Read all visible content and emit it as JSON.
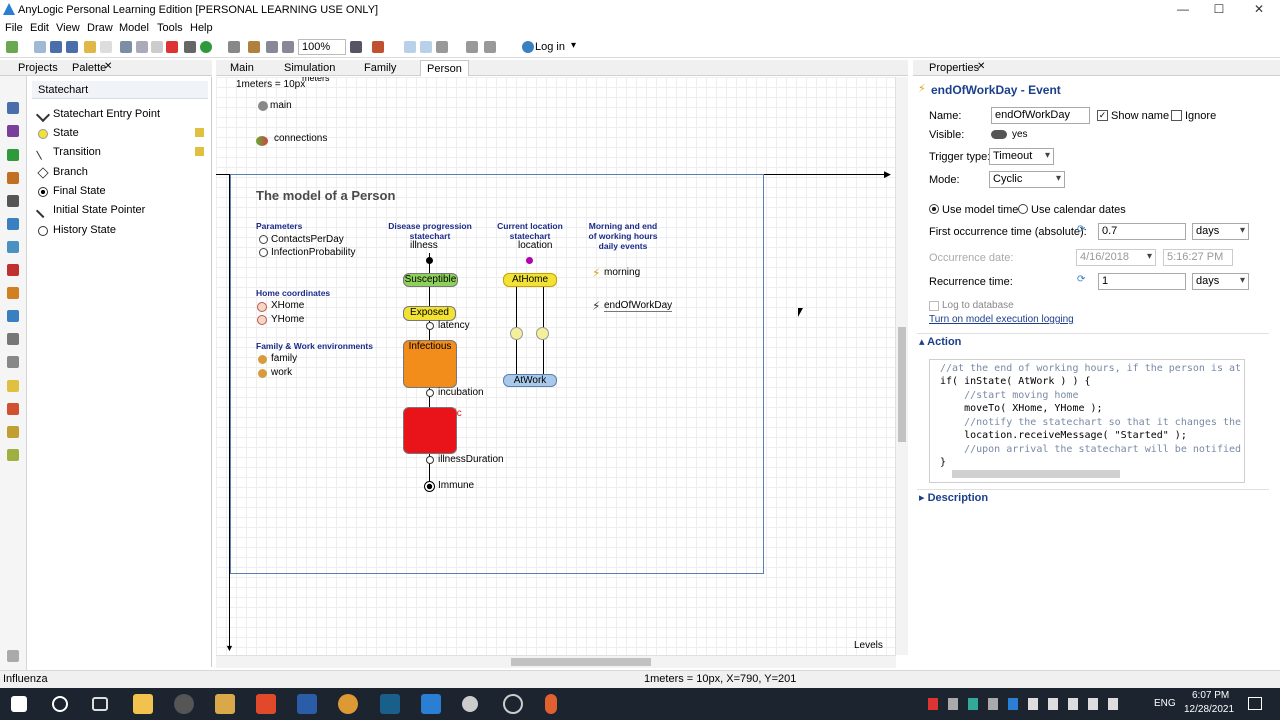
{
  "window": {
    "title": "AnyLogic Personal Learning Edition [PERSONAL LEARNING USE ONLY]",
    "minimize": "—",
    "maximize": "☐",
    "close": "✕"
  },
  "menu": [
    "File",
    "Edit",
    "View",
    "Draw",
    "Model",
    "Tools",
    "Help"
  ],
  "toolbar": {
    "zoom": "100%",
    "login": "Log in"
  },
  "left_panel": {
    "tabs": [
      "Projects",
      "Palette"
    ],
    "palette_section": "Statechart",
    "items": [
      {
        "label": "Statechart Entry Point",
        "icon": "entry-point-icon"
      },
      {
        "label": "State",
        "icon": "state-icon"
      },
      {
        "label": "Transition",
        "icon": "transition-icon"
      },
      {
        "label": "Branch",
        "icon": "branch-icon"
      },
      {
        "label": "Final State",
        "icon": "final-state-icon"
      },
      {
        "label": "Initial State Pointer",
        "icon": "initial-pointer-icon"
      },
      {
        "label": "History State",
        "icon": "history-state-icon"
      }
    ]
  },
  "editor": {
    "tabs": [
      "Main",
      "Simulation",
      "Family",
      "Person"
    ],
    "active_tab": "Person",
    "scale_label": "1meters = 10px",
    "scale_unit": "meters",
    "main_label": "main",
    "connections_label": "connections",
    "frame_title": "The model of a Person",
    "parameters_head": "Parameters",
    "parameters": [
      "ContactsPerDay",
      "InfectionProbability"
    ],
    "home_head": "Home coordinates",
    "home_vars": [
      "XHome",
      "YHome"
    ],
    "env_head": "Family & Work environments",
    "env_vars": [
      "family",
      "work"
    ],
    "disease_head": "Disease progression statechart",
    "disease_name": "illness",
    "disease_states": [
      "Susceptible",
      "Exposed",
      "Infectious",
      "Symptomatic"
    ],
    "disease_transitions": [
      "latency",
      "incubation",
      "illnessDuration"
    ],
    "final_state": "Immune",
    "location_head": "Current location statechart",
    "location_name": "location",
    "location_states": [
      "AtHome",
      "AtWork"
    ],
    "events_head": "Morning and end of working hours daily events",
    "events": [
      "morning",
      "endOfWorkDay"
    ],
    "levels": "Levels"
  },
  "properties": {
    "tab": "Properties",
    "header": "endOfWorkDay - Event",
    "name_label": "Name:",
    "name_value": "endOfWorkDay",
    "show_name": "Show name",
    "show_name_checked": true,
    "ignore": "Ignore",
    "visible_label": "Visible:",
    "visible_value": "yes",
    "trigger_label": "Trigger type:",
    "trigger_value": "Timeout",
    "mode_label": "Mode:",
    "mode_value": "Cyclic",
    "time_model": "Use model time",
    "time_calendar": "Use calendar dates",
    "first_label": "First occurrence time (absolute):",
    "first_value": "0.7",
    "first_unit": "days",
    "occ_date_label": "Occurrence date:",
    "occ_date": "4/16/2018",
    "occ_time": "5:16:27 PM",
    "recurrence_label": "Recurrence time:",
    "recurrence_value": "1",
    "recurrence_unit": "days",
    "log_db": "Log to database",
    "logging_link": "Turn on model execution logging",
    "action_section": "Action",
    "code": [
      "//at the end of working hours, if the person is at",
      "if( inState( AtWork ) ) {",
      "    //start moving home",
      "    moveTo( XHome, YHome );",
      "    //notify the statechart so that it changes the",
      "    location.receiveMessage( \"Started\" );",
      "    //upon arrival the statechart will be notified",
      "}"
    ],
    "description_section": "Description"
  },
  "status": {
    "left": "Influenza",
    "coords": "1meters = 10px, X=790, Y=201"
  },
  "taskbar": {
    "lang": "ENG",
    "time": "6:07 PM",
    "date": "12/28/2021"
  }
}
